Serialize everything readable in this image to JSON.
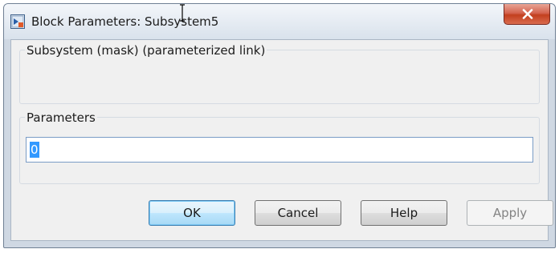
{
  "window": {
    "title": "Block Parameters: Subsystem5"
  },
  "mask_group": {
    "label": "Subsystem (mask) (parameterized link)"
  },
  "parameters_group": {
    "label": "Parameters",
    "input_value": "0"
  },
  "buttons": {
    "ok": "OK",
    "cancel": "Cancel",
    "help": "Help",
    "apply": "Apply"
  },
  "icons": {
    "app": "simulink-block-icon",
    "close": "close-icon",
    "cursor": "text-cursor-icon"
  },
  "colors": {
    "close_button": "#c2401f",
    "selection": "#3399ff",
    "ok_border": "#3c7fb1",
    "disabled_text": "#838383"
  }
}
